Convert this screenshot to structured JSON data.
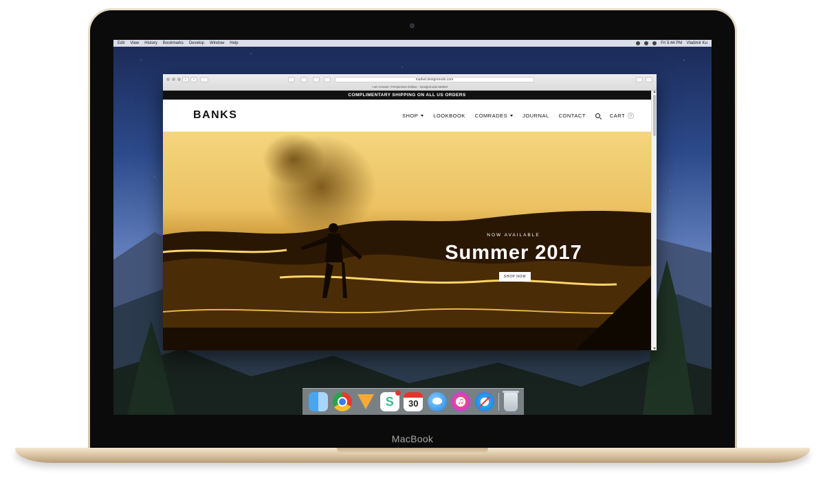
{
  "device": {
    "brand_label": "MacBook"
  },
  "menubar": {
    "items": [
      "Edit",
      "View",
      "History",
      "Bookmarks",
      "Develop",
      "Window",
      "Help"
    ],
    "clock": "Fri 5:44 PM",
    "user": "Vladimir Ku"
  },
  "browser": {
    "url": "market.designmodo.com",
    "tab_title": "I am Creator: Perspective Edition - Designmodo Market"
  },
  "site": {
    "announcement": "COMPLIMENTARY SHIPPING ON ALL US ORDERS",
    "logo": "BANKS",
    "nav": {
      "shop": "SHOP",
      "lookbook": "LOOKBOOK",
      "comrades": "COMRADES",
      "journal": "JOURNAL",
      "contact": "CONTACT",
      "cart": "CART",
      "cart_count": "0"
    },
    "hero": {
      "eyebrow": "NOW AVAILABLE",
      "title": "Summer 2017",
      "cta": "SHOP NOW"
    }
  },
  "dock": {
    "apps": [
      "finder-icon",
      "chrome-icon",
      "sketch-icon",
      "slack-icon",
      "calendar-icon",
      "messages-icon",
      "itunes-icon",
      "safari-icon",
      "trash-icon"
    ],
    "calendar_day": "30"
  }
}
